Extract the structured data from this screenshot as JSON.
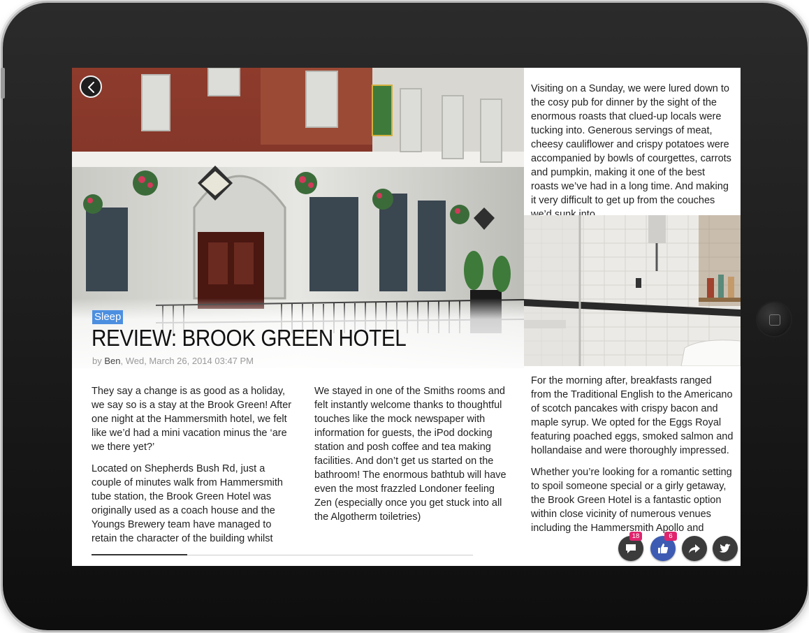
{
  "article": {
    "category_tag": "Sleep",
    "title": "REVIEW: BROOK GREEN HOTEL",
    "by_prefix": "by ",
    "author": "Ben",
    "date": ", Wed, March 26, 2014 03:47 PM",
    "paragraphs_col1": [
      "They say a change is as good as a holiday, we say so is a stay at the Brook Green! After one night at the Hammersmith hotel, we felt like we’d had a mini vacation minus the ‘are we there yet?’",
      "Located on Shepherds Bush Rd, just a couple of minutes walk from Hammersmith tube station, the Brook Green Hotel was originally used as a coach house and the Youngs Brewery team have managed to retain the character of the building whilst creating a modern pub and hotel."
    ],
    "paragraphs_col2": [
      "We stayed in one of the Smiths rooms and felt instantly welcome thanks to thoughtful touches like the mock newspaper with information for guests, the iPod docking station and posh coffee and tea making facilities. And don’t get us started on the bathroom! The enormous bathtub will have even the most frazzled Londoner feeling Zen (especially once you get stuck into all the Algotherm toiletries)"
    ],
    "paragraphs_col3": [
      "Visiting on a Sunday, we were lured down to the cosy pub for dinner by the sight of the enormous roasts that clued-up locals were tucking into. Generous servings of meat, cheesy cauliflower and crispy potatoes were accompanied by bowls of courgettes, carrots and pumpkin, making it one of the best roasts we’ve had in a long time. And making it very difficult to get up from the couches we’d sunk into."
    ],
    "paragraphs_col4": [
      "For the morning after, breakfasts ranged from the Traditional English to the Americano of scotch pancakes with crispy bacon and maple syrup. We opted for the Eggs Royal featuring poached eggs, smoked salmon and hollandaise and were thoroughly impressed.",
      "Whether you’re looking for a romantic setting to spoil someone special or a girly getaway, the Brook Green Hotel is a fantastic option within close vicinity of numerous venues including the Hammersmith Apollo and Shepherds Bush"
    ]
  },
  "reading_progress": 0.25,
  "actions": {
    "comments_count": "18",
    "likes_count": "6"
  },
  "icons": [
    "back-chevron-icon",
    "comment-icon",
    "thumbs-up-icon",
    "share-arrow-icon",
    "twitter-bird-icon"
  ],
  "colors": {
    "tag_bg": "#4c8fe0",
    "badge": "#e0246d",
    "like_active": "#3d5bb3",
    "action_button": "#3b3b3b"
  }
}
